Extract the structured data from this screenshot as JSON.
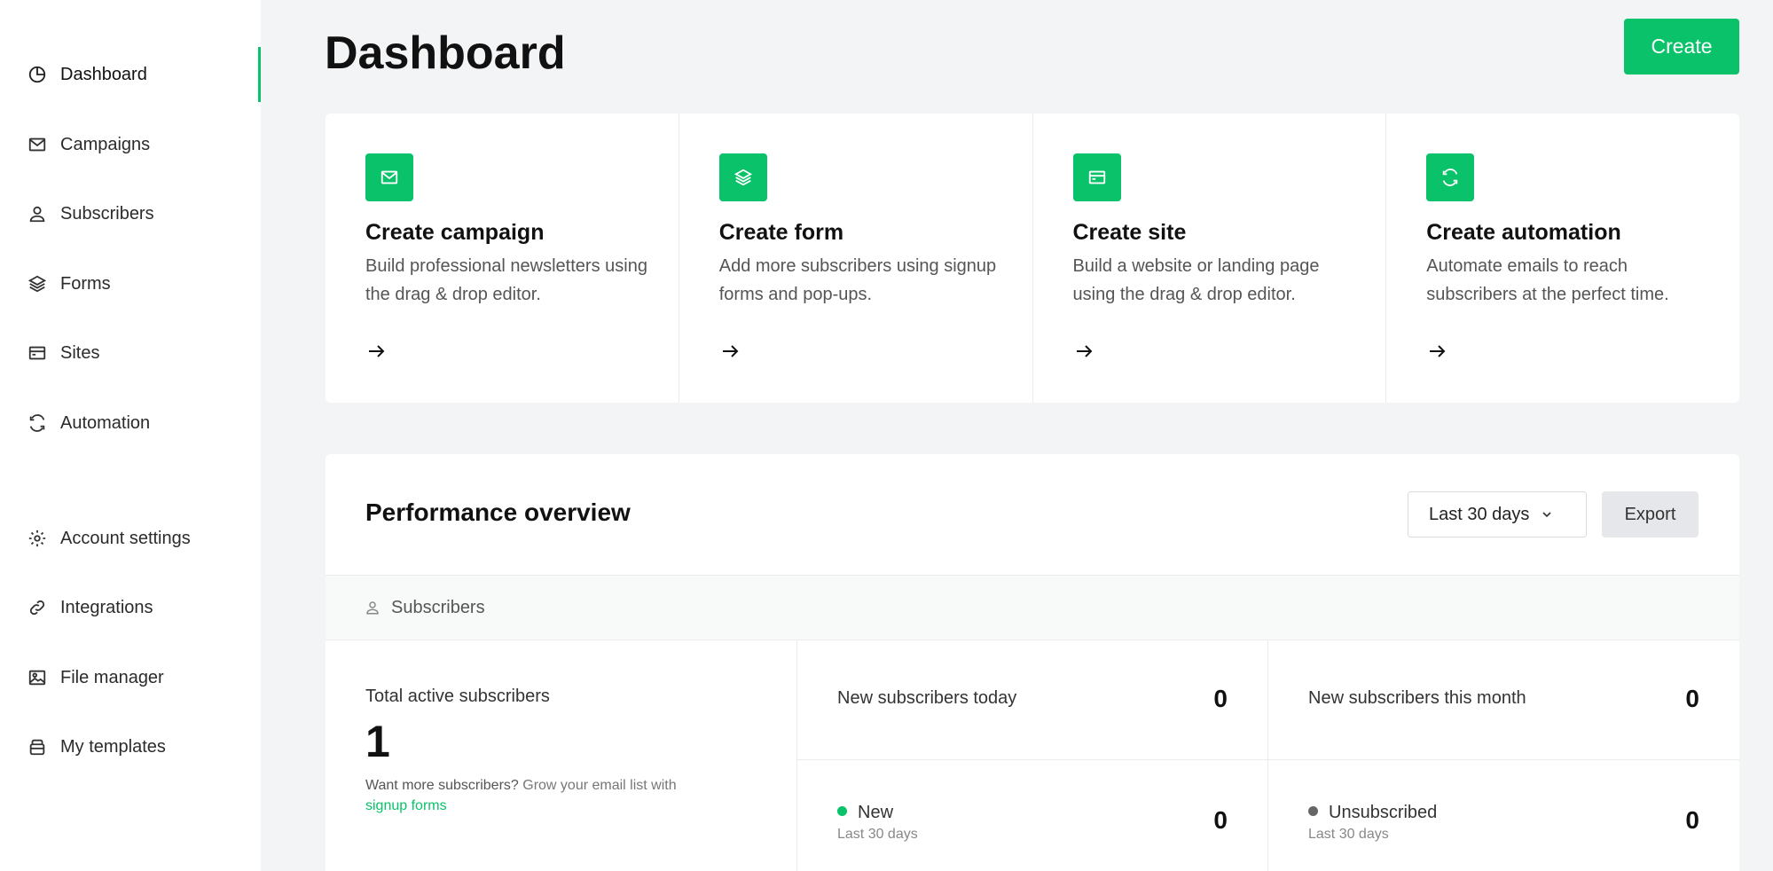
{
  "sidebar": {
    "items": [
      {
        "label": "Dashboard",
        "icon": "dashboard-icon"
      },
      {
        "label": "Campaigns",
        "icon": "mail-icon"
      },
      {
        "label": "Subscribers",
        "icon": "user-icon"
      },
      {
        "label": "Forms",
        "icon": "layers-icon"
      },
      {
        "label": "Sites",
        "icon": "site-icon"
      },
      {
        "label": "Automation",
        "icon": "refresh-icon"
      }
    ],
    "bottom_items": [
      {
        "label": "Account settings",
        "icon": "gear-icon"
      },
      {
        "label": "Integrations",
        "icon": "link-icon"
      },
      {
        "label": "File manager",
        "icon": "image-icon"
      },
      {
        "label": "My templates",
        "icon": "template-icon"
      }
    ]
  },
  "header": {
    "title": "Dashboard",
    "create_label": "Create"
  },
  "cards": [
    {
      "title": "Create campaign",
      "desc": "Build professional newsletters using the drag & drop editor.",
      "icon": "mail-icon"
    },
    {
      "title": "Create form",
      "desc": "Add more subscribers using signup forms and pop-ups.",
      "icon": "layers-icon"
    },
    {
      "title": "Create site",
      "desc": "Build a website or landing page using the drag & drop editor.",
      "icon": "site-icon"
    },
    {
      "title": "Create automation",
      "desc": "Automate emails to reach subscribers at the perfect time.",
      "icon": "refresh-icon"
    }
  ],
  "performance": {
    "title": "Performance overview",
    "range": "Last 30 days",
    "export_label": "Export",
    "section": "Subscribers",
    "total_label": "Total active subscribers",
    "total_value": "1",
    "hint_prefix": "Want more subscribers?",
    "hint_text": "Grow your email list with",
    "hint_link": "signup forms",
    "stats": {
      "today_label": "New subscribers today",
      "today_value": "0",
      "month_label": "New subscribers this month",
      "month_value": "0",
      "new_label": "New",
      "new_sub": "Last 30 days",
      "new_value": "0",
      "unsub_label": "Unsubscribed",
      "unsub_sub": "Last 30 days",
      "unsub_value": "0"
    }
  },
  "colors": {
    "accent": "#09c269",
    "unsubscribed_dot": "#666666"
  }
}
